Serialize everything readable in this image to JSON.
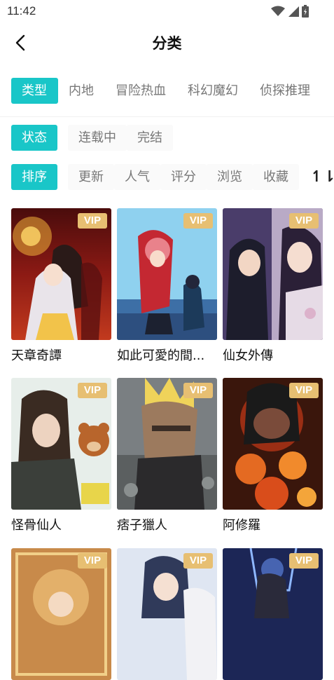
{
  "status_bar": {
    "time": "11:42",
    "icons": [
      "wifi-icon",
      "cell-signal-icon",
      "battery-icon"
    ]
  },
  "header": {
    "title": "分类",
    "back_icon": "chevron-left-icon"
  },
  "filters": {
    "type": {
      "label": "类型",
      "options": [
        "内地",
        "冒险热血",
        "科幻魔幻",
        "侦探推理"
      ]
    },
    "status": {
      "label": "状态",
      "options": [
        "连载中",
        "完结"
      ]
    },
    "sort": {
      "label": "排序",
      "options": [
        "更新",
        "人气",
        "评分",
        "浏览",
        "收藏"
      ]
    }
  },
  "accent_color": "#19c6c8",
  "vip_color": "#e7bf72",
  "comics": [
    {
      "title": "天章奇譚",
      "badge": "VIP"
    },
    {
      "title": "如此可愛的間...",
      "badge": "VIP"
    },
    {
      "title": "仙女外傳",
      "badge": "VIP"
    },
    {
      "title": "怪骨仙人",
      "badge": "VIP"
    },
    {
      "title": "痞子獵人",
      "badge": "VIP"
    },
    {
      "title": "阿修羅",
      "badge": "VIP"
    },
    {
      "title": "",
      "badge": "VIP"
    },
    {
      "title": "",
      "badge": "VIP"
    },
    {
      "title": "",
      "badge": "VIP"
    }
  ]
}
